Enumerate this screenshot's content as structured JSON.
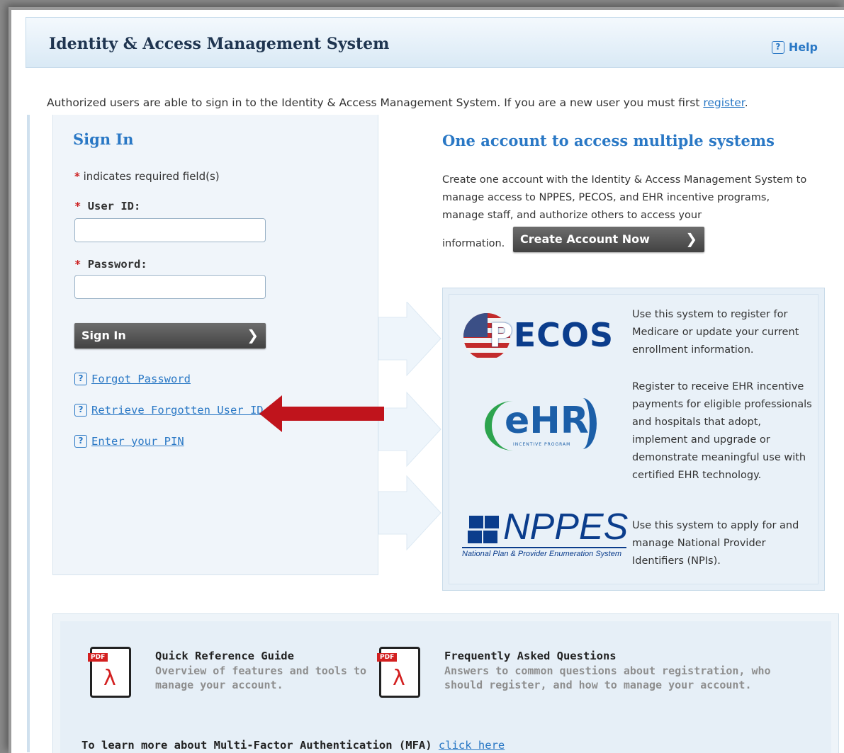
{
  "header": {
    "title": "Identity & Access Management System",
    "help_label": "Help",
    "help_icon": "question-icon"
  },
  "intro": {
    "text": "Authorized users are able to sign in to the Identity & Access Management System. If you are a new user you must first ",
    "register_link": "register",
    "period": "."
  },
  "signin": {
    "title": "Sign In",
    "required_star": "*",
    "required_note": "indicates required field(s)",
    "user_id_label": "User ID:",
    "user_id_value": "",
    "password_label": "Password:",
    "password_value": "",
    "button_label": "Sign In",
    "button_arrow": "❯",
    "links": [
      {
        "label": "Forgot Password",
        "icon": "question-icon"
      },
      {
        "label": "Retrieve Forgotten User ID",
        "icon": "question-icon"
      },
      {
        "label": "Enter your PIN",
        "icon": "question-icon"
      }
    ]
  },
  "account": {
    "title": "One account to access multiple systems",
    "description": "Create one account with the Identity & Access Management System to manage access to NPPES, PECOS, and EHR incentive programs, manage staff, and authorize others to access your",
    "info_word": "information.",
    "button_label": "Create Account Now",
    "button_arrow": "❯"
  },
  "systems": [
    {
      "logo_text": "ECOS",
      "logo_letter": "P",
      "description": "Use this system to register for Medicare or update your current enrollment information."
    },
    {
      "logo_text": "eHR",
      "logo_sub": "INCENTIVE PROGRAM",
      "description": "Register to receive EHR incentive payments for eligible professionals and hospitals that adopt, implement and upgrade or demonstrate meaningful use with certified EHR technology."
    },
    {
      "logo_text": "NPPES",
      "logo_sub": "National Plan & Provider Enumeration System",
      "description": "Use this system to apply for and manage National Provider Identifiers (NPIs)."
    }
  ],
  "resources": [
    {
      "title": "Quick Reference Guide",
      "description": "Overview of features and tools to manage your account.",
      "icon": "pdf-icon",
      "tag": "PDF"
    },
    {
      "title": "Frequently Asked Questions",
      "description": "Answers to common questions about registration, who should register, and how to manage your account.",
      "icon": "pdf-icon",
      "tag": "PDF"
    }
  ],
  "mfa": {
    "text": "To learn more about Multi-Factor Authentication (MFA) ",
    "link": "click here"
  },
  "colors": {
    "accent_blue": "#2a78c5",
    "required_red": "#cc1f1f",
    "annotation_arrow": "#c0141c"
  }
}
